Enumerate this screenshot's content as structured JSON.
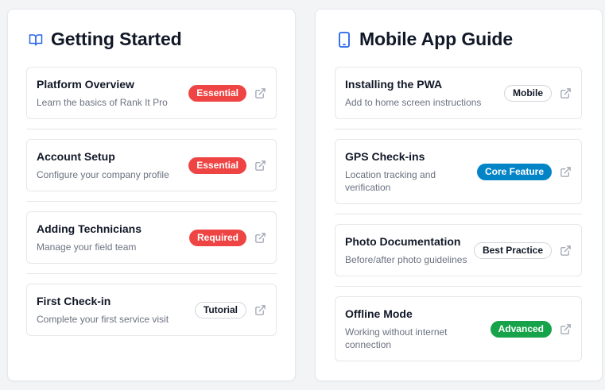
{
  "colors": {
    "accent": "#2563eb",
    "essential": "#ef4444",
    "core_feature": "#0284c7",
    "advanced": "#16a34a"
  },
  "getting_started": {
    "title": "Getting Started",
    "icon": "book-open-icon",
    "items": [
      {
        "title": "Platform Overview",
        "desc": "Learn the basics of Rank It Pro",
        "badge": "Essential",
        "badge_style": "red"
      },
      {
        "title": "Account Setup",
        "desc": "Configure your company profile",
        "badge": "Essential",
        "badge_style": "red"
      },
      {
        "title": "Adding Technicians",
        "desc": "Manage your field team",
        "badge": "Required",
        "badge_style": "red"
      },
      {
        "title": "First Check-in",
        "desc": "Complete your first service visit",
        "badge": "Tutorial",
        "badge_style": "outline"
      }
    ]
  },
  "mobile_guide": {
    "title": "Mobile App Guide",
    "icon": "smartphone-icon",
    "items": [
      {
        "title": "Installing the PWA",
        "desc": "Add to home screen instructions",
        "badge": "Mobile",
        "badge_style": "outline"
      },
      {
        "title": "GPS Check-ins",
        "desc": "Location tracking and verification",
        "badge": "Core Feature",
        "badge_style": "blue"
      },
      {
        "title": "Photo Documentation",
        "desc": "Before/after photo guidelines",
        "badge": "Best Practice",
        "badge_style": "outline"
      },
      {
        "title": "Offline Mode",
        "desc": "Working without internet connection",
        "badge": "Advanced",
        "badge_style": "green"
      }
    ]
  }
}
